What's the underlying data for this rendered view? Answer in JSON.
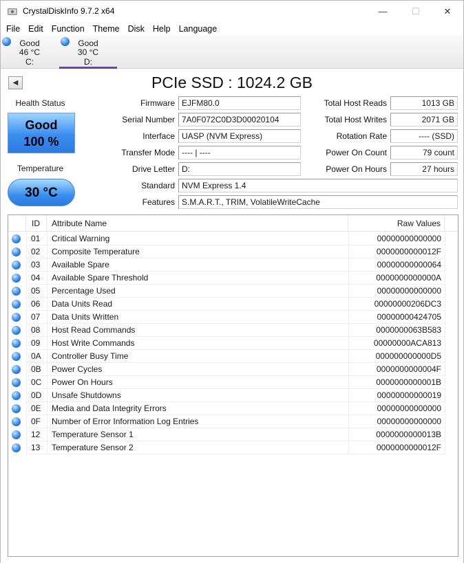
{
  "window": {
    "title": "CrystalDiskInfo 9.7.2 x64",
    "minimize": "—",
    "maximize": "☐",
    "close": "✕"
  },
  "menu": [
    "File",
    "Edit",
    "Function",
    "Theme",
    "Disk",
    "Help",
    "Language"
  ],
  "disks": [
    {
      "status": "Good",
      "temp": "46 °C",
      "letter": "C:"
    },
    {
      "status": "Good",
      "temp": "30 °C",
      "letter": "D:"
    }
  ],
  "disk_title": "PCIe SSD : 1024.2 GB",
  "prev_button": "◀",
  "health": {
    "label": "Health Status",
    "status": "Good",
    "percent": "100 %",
    "color": "#3a8df0"
  },
  "temperature": {
    "label": "Temperature",
    "value": "30 °C"
  },
  "info": {
    "firmware_label": "Firmware",
    "firmware": "EJFM80.0",
    "serial_label": "Serial Number",
    "serial": "7A0F072C0D3D00020104",
    "interface_label": "Interface",
    "interface": "UASP (NVM Express)",
    "transfer_label": "Transfer Mode",
    "transfer": "---- | ----",
    "drive_letter_label": "Drive Letter",
    "drive_letter": "D:",
    "standard_label": "Standard",
    "standard": "NVM Express 1.4",
    "features_label": "Features",
    "features": "S.M.A.R.T., TRIM, VolatileWriteCache"
  },
  "stats": {
    "reads_label": "Total Host Reads",
    "reads": "1013 GB",
    "writes_label": "Total Host Writes",
    "writes": "2071 GB",
    "rotation_label": "Rotation Rate",
    "rotation": "---- (SSD)",
    "power_count_label": "Power On Count",
    "power_count": "79 count",
    "power_hours_label": "Power On Hours",
    "power_hours": "27 hours"
  },
  "table": {
    "headers": {
      "id": "ID",
      "name": "Attribute Name",
      "raw": "Raw Values"
    },
    "rows": [
      {
        "id": "01",
        "name": "Critical Warning",
        "raw": "00000000000000"
      },
      {
        "id": "02",
        "name": "Composite Temperature",
        "raw": "0000000000012F"
      },
      {
        "id": "03",
        "name": "Available Spare",
        "raw": "00000000000064"
      },
      {
        "id": "04",
        "name": "Available Spare Threshold",
        "raw": "0000000000000A"
      },
      {
        "id": "05",
        "name": "Percentage Used",
        "raw": "00000000000000"
      },
      {
        "id": "06",
        "name": "Data Units Read",
        "raw": "00000000206DC3"
      },
      {
        "id": "07",
        "name": "Data Units Written",
        "raw": "00000000424705"
      },
      {
        "id": "08",
        "name": "Host Read Commands",
        "raw": "0000000063B583"
      },
      {
        "id": "09",
        "name": "Host Write Commands",
        "raw": "00000000ACA813"
      },
      {
        "id": "0A",
        "name": "Controller Busy Time",
        "raw": "000000000000D5"
      },
      {
        "id": "0B",
        "name": "Power Cycles",
        "raw": "0000000000004F"
      },
      {
        "id": "0C",
        "name": "Power On Hours",
        "raw": "0000000000001B"
      },
      {
        "id": "0D",
        "name": "Unsafe Shutdowns",
        "raw": "00000000000019"
      },
      {
        "id": "0E",
        "name": "Media and Data Integrity Errors",
        "raw": "00000000000000"
      },
      {
        "id": "0F",
        "name": "Number of Error Information Log Entries",
        "raw": "00000000000000"
      },
      {
        "id": "12",
        "name": "Temperature Sensor 1",
        "raw": "0000000000013B"
      },
      {
        "id": "13",
        "name": "Temperature Sensor 2",
        "raw": "0000000000012F"
      }
    ]
  }
}
